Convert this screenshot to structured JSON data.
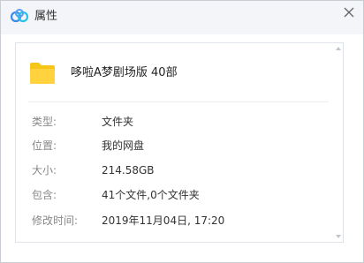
{
  "window": {
    "title": "属性"
  },
  "file": {
    "name": "哆啦A梦剧场版 40部"
  },
  "properties": [
    {
      "label": "类型:",
      "value": "文件夹"
    },
    {
      "label": "位置:",
      "value": "我的网盘"
    },
    {
      "label": "大小:",
      "value": "214.58GB"
    },
    {
      "label": "包含:",
      "value": "41个文件,0个文件夹"
    },
    {
      "label": "修改时间:",
      "value": "2019年11月04日, 17:20"
    }
  ],
  "icons": {
    "app": "baidu-cloud-logo-icon",
    "close": "close-icon",
    "folder": "folder-icon"
  },
  "colors": {
    "folder": "#f5c518",
    "logo_blue": "#3b8bea",
    "logo_cyan": "#2ac3e5"
  }
}
